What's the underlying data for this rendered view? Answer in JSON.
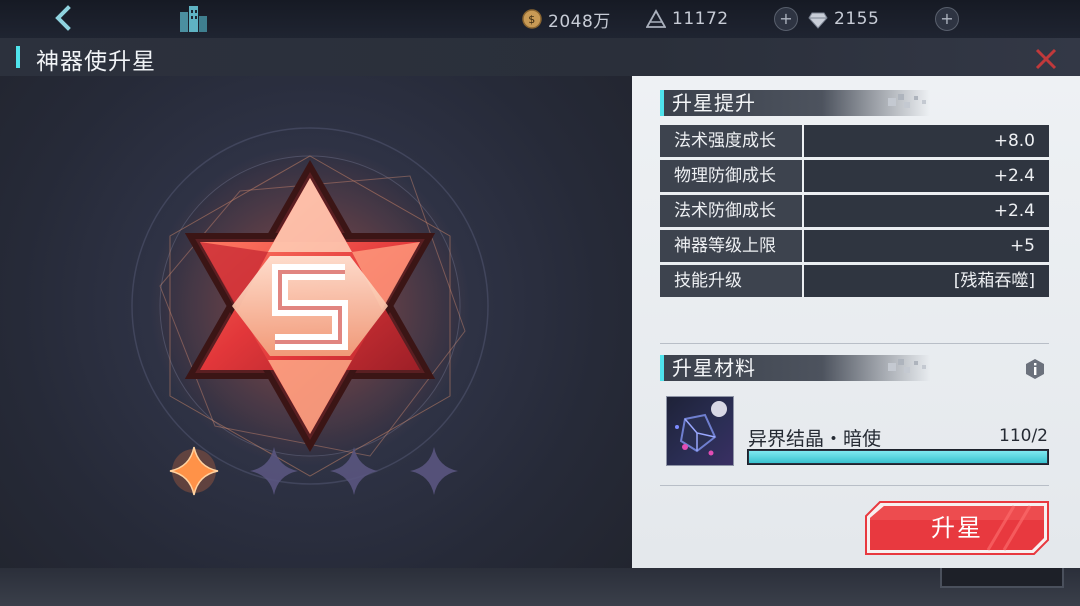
{
  "topbar": {
    "resources": [
      {
        "icon": "gold-coin-icon",
        "value": "2048万"
      },
      {
        "icon": "pyramid-crystal-icon",
        "value": "11172"
      },
      {
        "icon": "diamond-gem-icon",
        "value": "2155"
      }
    ]
  },
  "title": {
    "text": "神器使升星"
  },
  "stage": {
    "rank_glyph": "S",
    "stars_filled": 1,
    "stars_total": 4
  },
  "upgrade_section": {
    "header": "升星提升",
    "stats": [
      {
        "label": "法术强度成长",
        "value": "+8.0"
      },
      {
        "label": "物理防御成长",
        "value": "+2.4"
      },
      {
        "label": "法术防御成长",
        "value": "+2.4"
      },
      {
        "label": "神器等级上限",
        "value": "+5"
      },
      {
        "label": "技能升级",
        "value": "[残葙吞噬]"
      }
    ]
  },
  "material_section": {
    "header": "升星材料",
    "item": {
      "name": "异界结晶・暗使",
      "count": "110/2",
      "progress": 1.0
    }
  },
  "actions": {
    "upgrade_label": "升星"
  },
  "colors": {
    "accent": "#4fe3ec",
    "button_red": "#e8393f",
    "panel_bg": "#e9ecef"
  }
}
